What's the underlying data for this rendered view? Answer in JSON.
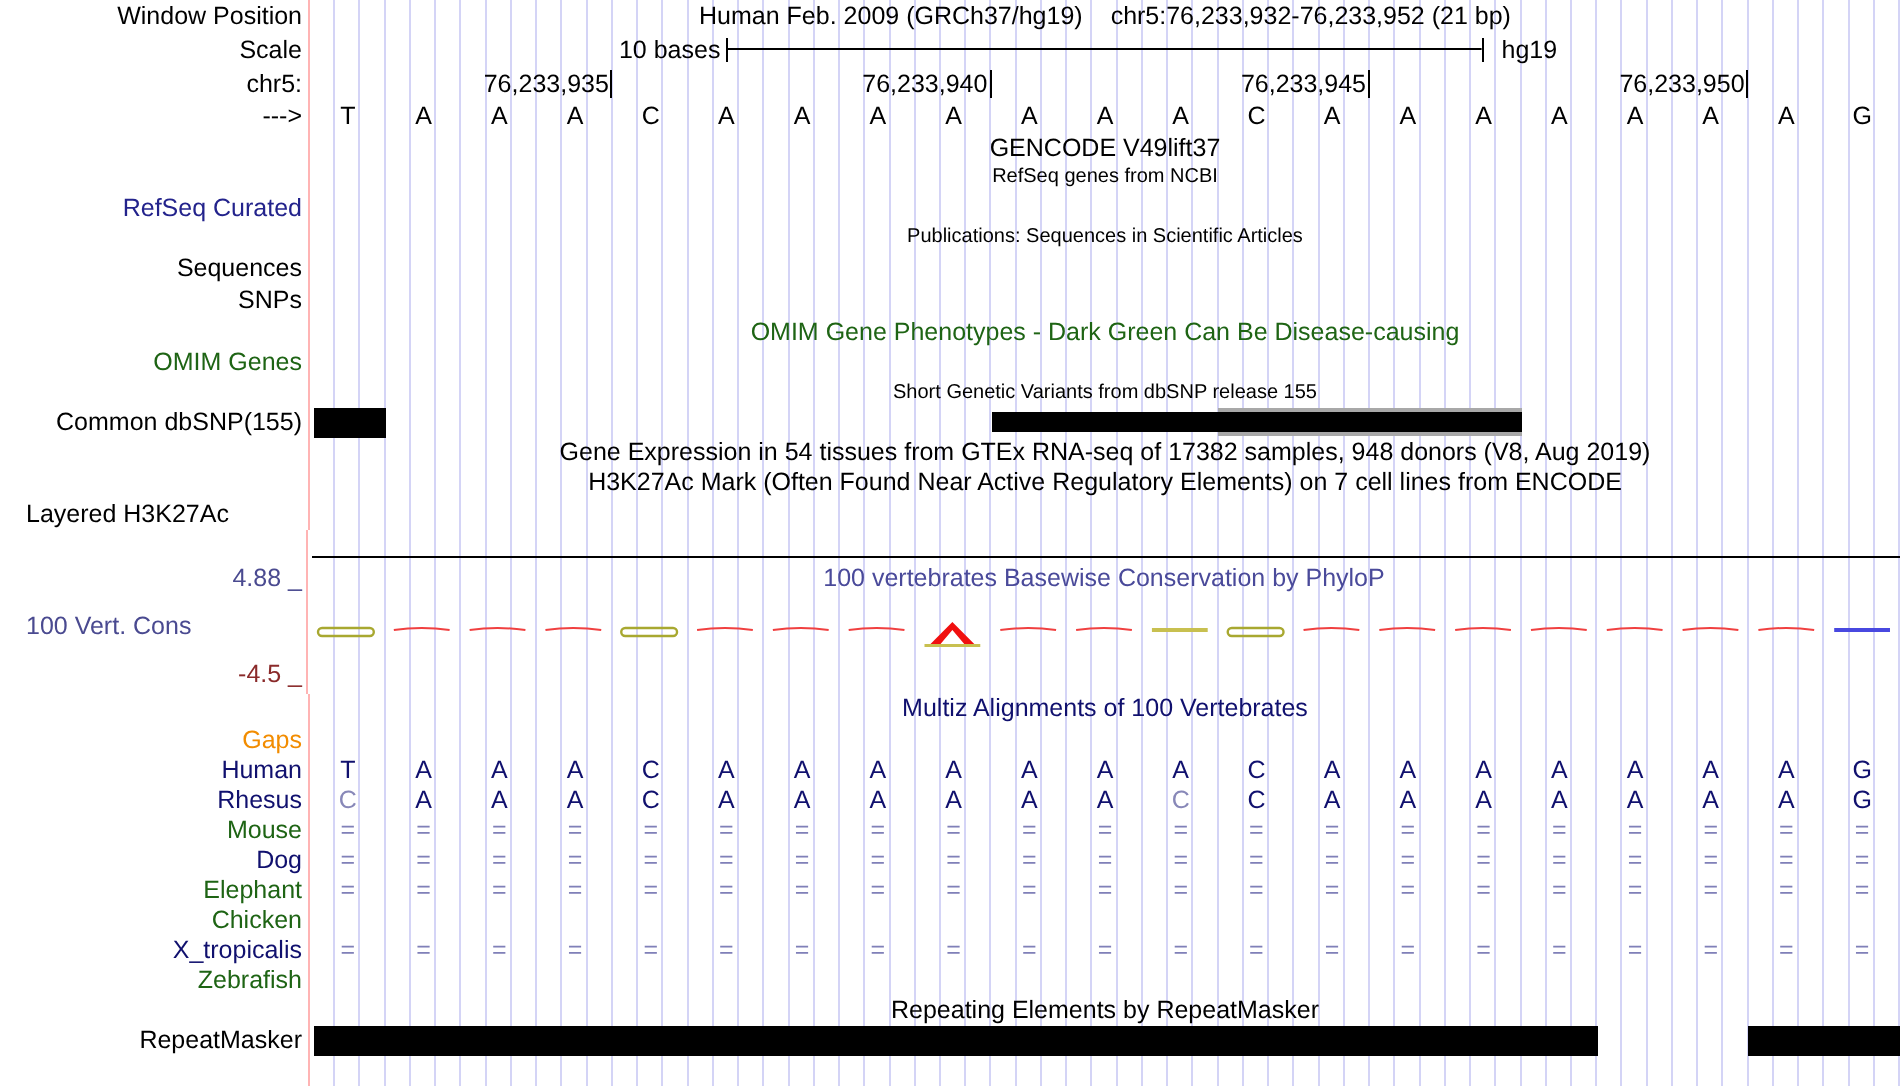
{
  "rows": [
    {
      "kind": "position",
      "label": "Window Position",
      "title": "Human Feb. 2009 (GRCh37/hg19)",
      "range": "chr5:76,233,932-76,233,952 (21 bp)"
    },
    {
      "kind": "scale",
      "label": "Scale",
      "span": "10 bases",
      "assembly": "hg19"
    },
    {
      "kind": "coordinates",
      "label": "chr5:",
      "ticks": [
        "76,233,935",
        "76,233,940",
        "76,233,945",
        "76,233,950"
      ]
    },
    {
      "kind": "sequence",
      "label": "--->",
      "bases": [
        "T",
        "A",
        "A",
        "A",
        "C",
        "A",
        "A",
        "A",
        "A",
        "A",
        "A",
        "A",
        "C",
        "A",
        "A",
        "A",
        "A",
        "A",
        "A",
        "A",
        "G"
      ]
    },
    {
      "kind": "caption",
      "text": "GENCODE V49lift37"
    },
    {
      "kind": "note",
      "text": "RefSeq genes from NCBI"
    },
    {
      "kind": "track",
      "label": "RefSeq Curated",
      "color": "#23238c"
    },
    {
      "kind": "note",
      "text": "Publications: Sequences in Scientific Articles"
    },
    {
      "kind": "track",
      "label": "Sequences"
    },
    {
      "kind": "track",
      "label": "SNPs"
    },
    {
      "kind": "caption",
      "text": "OMIM Gene Phenotypes - Dark Green Can Be Disease-causing",
      "color": "#1e6414"
    },
    {
      "kind": "track",
      "label": "OMIM Genes",
      "color": "#1e6414"
    },
    {
      "kind": "note",
      "text": "Short Genetic Variants from dbSNP release 155"
    },
    {
      "kind": "snp_track",
      "label": "Common dbSNP(155)"
    },
    {
      "kind": "caption",
      "text": "Gene Expression in 54 tissues from GTEx RNA-seq of 17382 samples, 948 donors (V8, Aug 2019)"
    },
    {
      "kind": "caption",
      "text": "H3K27Ac Mark (Often Found Near Active Regulatory Elements) on 7 cell lines from ENCODE"
    },
    {
      "kind": "composite_track",
      "label": "Layered H3K27Ac"
    },
    {
      "kind": "conservation",
      "label": "100 Vert. Cons",
      "title": "100 vertebrates Basewise Conservation by PhyloP",
      "max": "4.88 _",
      "min": "-4.5 _"
    },
    {
      "kind": "caption",
      "text": "Multiz Alignments of 100 Vertebrates",
      "color": "#10106e"
    },
    {
      "kind": "track",
      "label": "Gaps",
      "color": "#f28c00"
    },
    {
      "kind": "alignment",
      "label": "Human",
      "color": "#10106e",
      "bases": [
        "T",
        "A",
        "A",
        "A",
        "C",
        "A",
        "A",
        "A",
        "A",
        "A",
        "A",
        "A",
        "C",
        "A",
        "A",
        "A",
        "A",
        "A",
        "A",
        "A",
        "G"
      ]
    },
    {
      "kind": "alignment",
      "label": "Rhesus",
      "color": "#10106e",
      "bases": [
        "C",
        "A",
        "A",
        "A",
        "C",
        "A",
        "A",
        "A",
        "A",
        "A",
        "A",
        "C",
        "C",
        "A",
        "A",
        "A",
        "A",
        "A",
        "A",
        "A",
        "G"
      ]
    },
    {
      "kind": "alignment",
      "label": "Mouse",
      "color": "#1e6414",
      "bases": [
        "=",
        "=",
        "=",
        "=",
        "=",
        "=",
        "=",
        "=",
        "=",
        "=",
        "=",
        "=",
        "=",
        "=",
        "=",
        "=",
        "=",
        "=",
        "=",
        "=",
        "="
      ]
    },
    {
      "kind": "alignment",
      "label": "Dog",
      "color": "#10106e",
      "bases": [
        "=",
        "=",
        "=",
        "=",
        "=",
        "=",
        "=",
        "=",
        "=",
        "=",
        "=",
        "=",
        "=",
        "=",
        "=",
        "=",
        "=",
        "=",
        "=",
        "=",
        "="
      ]
    },
    {
      "kind": "alignment",
      "label": "Elephant",
      "color": "#1e6414",
      "bases": [
        "=",
        "=",
        "=",
        "=",
        "=",
        "=",
        "=",
        "=",
        "=",
        "=",
        "=",
        "=",
        "=",
        "=",
        "=",
        "=",
        "=",
        "=",
        "=",
        "=",
        "="
      ]
    },
    {
      "kind": "alignment",
      "label": "Chicken",
      "color": "#1e6414"
    },
    {
      "kind": "alignment",
      "label": "X_tropicalis",
      "color": "#10106e",
      "bases": [
        "=",
        "=",
        "=",
        "=",
        "=",
        "=",
        "=",
        "=",
        "=",
        "=",
        "=",
        "=",
        "=",
        "=",
        "=",
        "=",
        "=",
        "=",
        "=",
        "=",
        "="
      ]
    },
    {
      "kind": "alignment",
      "label": "Zebrafish",
      "color": "#1e6414"
    },
    {
      "kind": "caption",
      "text": "Repeating Elements by RepeatMasker"
    },
    {
      "kind": "repeat_track",
      "label": "RepeatMasker"
    }
  ]
}
